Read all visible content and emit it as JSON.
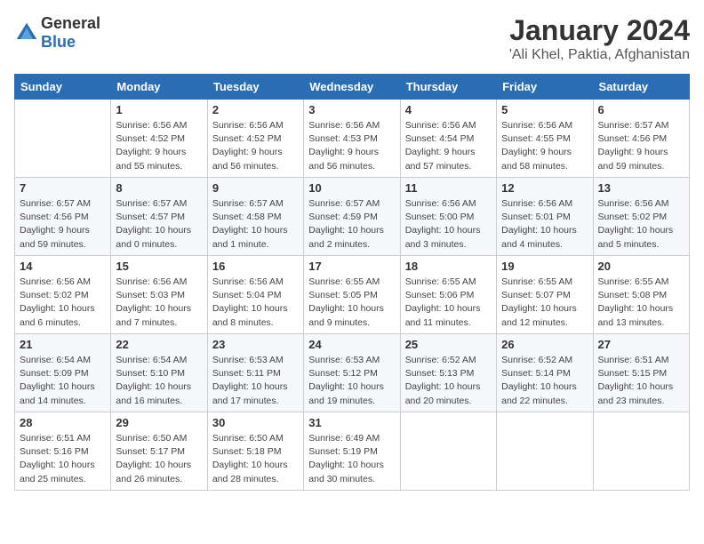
{
  "logo": {
    "general": "General",
    "blue": "Blue"
  },
  "header": {
    "month": "January 2024",
    "location": "'Ali Khel, Paktia, Afghanistan"
  },
  "weekdays": [
    "Sunday",
    "Monday",
    "Tuesday",
    "Wednesday",
    "Thursday",
    "Friday",
    "Saturday"
  ],
  "weeks": [
    [
      {
        "day": "",
        "sunrise": "",
        "sunset": "",
        "daylight": ""
      },
      {
        "day": "1",
        "sunrise": "Sunrise: 6:56 AM",
        "sunset": "Sunset: 4:52 PM",
        "daylight": "Daylight: 9 hours and 55 minutes."
      },
      {
        "day": "2",
        "sunrise": "Sunrise: 6:56 AM",
        "sunset": "Sunset: 4:52 PM",
        "daylight": "Daylight: 9 hours and 56 minutes."
      },
      {
        "day": "3",
        "sunrise": "Sunrise: 6:56 AM",
        "sunset": "Sunset: 4:53 PM",
        "daylight": "Daylight: 9 hours and 56 minutes."
      },
      {
        "day": "4",
        "sunrise": "Sunrise: 6:56 AM",
        "sunset": "Sunset: 4:54 PM",
        "daylight": "Daylight: 9 hours and 57 minutes."
      },
      {
        "day": "5",
        "sunrise": "Sunrise: 6:56 AM",
        "sunset": "Sunset: 4:55 PM",
        "daylight": "Daylight: 9 hours and 58 minutes."
      },
      {
        "day": "6",
        "sunrise": "Sunrise: 6:57 AM",
        "sunset": "Sunset: 4:56 PM",
        "daylight": "Daylight: 9 hours and 59 minutes."
      }
    ],
    [
      {
        "day": "7",
        "sunrise": "Sunrise: 6:57 AM",
        "sunset": "Sunset: 4:56 PM",
        "daylight": "Daylight: 9 hours and 59 minutes."
      },
      {
        "day": "8",
        "sunrise": "Sunrise: 6:57 AM",
        "sunset": "Sunset: 4:57 PM",
        "daylight": "Daylight: 10 hours and 0 minutes."
      },
      {
        "day": "9",
        "sunrise": "Sunrise: 6:57 AM",
        "sunset": "Sunset: 4:58 PM",
        "daylight": "Daylight: 10 hours and 1 minute."
      },
      {
        "day": "10",
        "sunrise": "Sunrise: 6:57 AM",
        "sunset": "Sunset: 4:59 PM",
        "daylight": "Daylight: 10 hours and 2 minutes."
      },
      {
        "day": "11",
        "sunrise": "Sunrise: 6:56 AM",
        "sunset": "Sunset: 5:00 PM",
        "daylight": "Daylight: 10 hours and 3 minutes."
      },
      {
        "day": "12",
        "sunrise": "Sunrise: 6:56 AM",
        "sunset": "Sunset: 5:01 PM",
        "daylight": "Daylight: 10 hours and 4 minutes."
      },
      {
        "day": "13",
        "sunrise": "Sunrise: 6:56 AM",
        "sunset": "Sunset: 5:02 PM",
        "daylight": "Daylight: 10 hours and 5 minutes."
      }
    ],
    [
      {
        "day": "14",
        "sunrise": "Sunrise: 6:56 AM",
        "sunset": "Sunset: 5:02 PM",
        "daylight": "Daylight: 10 hours and 6 minutes."
      },
      {
        "day": "15",
        "sunrise": "Sunrise: 6:56 AM",
        "sunset": "Sunset: 5:03 PM",
        "daylight": "Daylight: 10 hours and 7 minutes."
      },
      {
        "day": "16",
        "sunrise": "Sunrise: 6:56 AM",
        "sunset": "Sunset: 5:04 PM",
        "daylight": "Daylight: 10 hours and 8 minutes."
      },
      {
        "day": "17",
        "sunrise": "Sunrise: 6:55 AM",
        "sunset": "Sunset: 5:05 PM",
        "daylight": "Daylight: 10 hours and 9 minutes."
      },
      {
        "day": "18",
        "sunrise": "Sunrise: 6:55 AM",
        "sunset": "Sunset: 5:06 PM",
        "daylight": "Daylight: 10 hours and 11 minutes."
      },
      {
        "day": "19",
        "sunrise": "Sunrise: 6:55 AM",
        "sunset": "Sunset: 5:07 PM",
        "daylight": "Daylight: 10 hours and 12 minutes."
      },
      {
        "day": "20",
        "sunrise": "Sunrise: 6:55 AM",
        "sunset": "Sunset: 5:08 PM",
        "daylight": "Daylight: 10 hours and 13 minutes."
      }
    ],
    [
      {
        "day": "21",
        "sunrise": "Sunrise: 6:54 AM",
        "sunset": "Sunset: 5:09 PM",
        "daylight": "Daylight: 10 hours and 14 minutes."
      },
      {
        "day": "22",
        "sunrise": "Sunrise: 6:54 AM",
        "sunset": "Sunset: 5:10 PM",
        "daylight": "Daylight: 10 hours and 16 minutes."
      },
      {
        "day": "23",
        "sunrise": "Sunrise: 6:53 AM",
        "sunset": "Sunset: 5:11 PM",
        "daylight": "Daylight: 10 hours and 17 minutes."
      },
      {
        "day": "24",
        "sunrise": "Sunrise: 6:53 AM",
        "sunset": "Sunset: 5:12 PM",
        "daylight": "Daylight: 10 hours and 19 minutes."
      },
      {
        "day": "25",
        "sunrise": "Sunrise: 6:52 AM",
        "sunset": "Sunset: 5:13 PM",
        "daylight": "Daylight: 10 hours and 20 minutes."
      },
      {
        "day": "26",
        "sunrise": "Sunrise: 6:52 AM",
        "sunset": "Sunset: 5:14 PM",
        "daylight": "Daylight: 10 hours and 22 minutes."
      },
      {
        "day": "27",
        "sunrise": "Sunrise: 6:51 AM",
        "sunset": "Sunset: 5:15 PM",
        "daylight": "Daylight: 10 hours and 23 minutes."
      }
    ],
    [
      {
        "day": "28",
        "sunrise": "Sunrise: 6:51 AM",
        "sunset": "Sunset: 5:16 PM",
        "daylight": "Daylight: 10 hours and 25 minutes."
      },
      {
        "day": "29",
        "sunrise": "Sunrise: 6:50 AM",
        "sunset": "Sunset: 5:17 PM",
        "daylight": "Daylight: 10 hours and 26 minutes."
      },
      {
        "day": "30",
        "sunrise": "Sunrise: 6:50 AM",
        "sunset": "Sunset: 5:18 PM",
        "daylight": "Daylight: 10 hours and 28 minutes."
      },
      {
        "day": "31",
        "sunrise": "Sunrise: 6:49 AM",
        "sunset": "Sunset: 5:19 PM",
        "daylight": "Daylight: 10 hours and 30 minutes."
      },
      {
        "day": "",
        "sunrise": "",
        "sunset": "",
        "daylight": ""
      },
      {
        "day": "",
        "sunrise": "",
        "sunset": "",
        "daylight": ""
      },
      {
        "day": "",
        "sunrise": "",
        "sunset": "",
        "daylight": ""
      }
    ]
  ]
}
